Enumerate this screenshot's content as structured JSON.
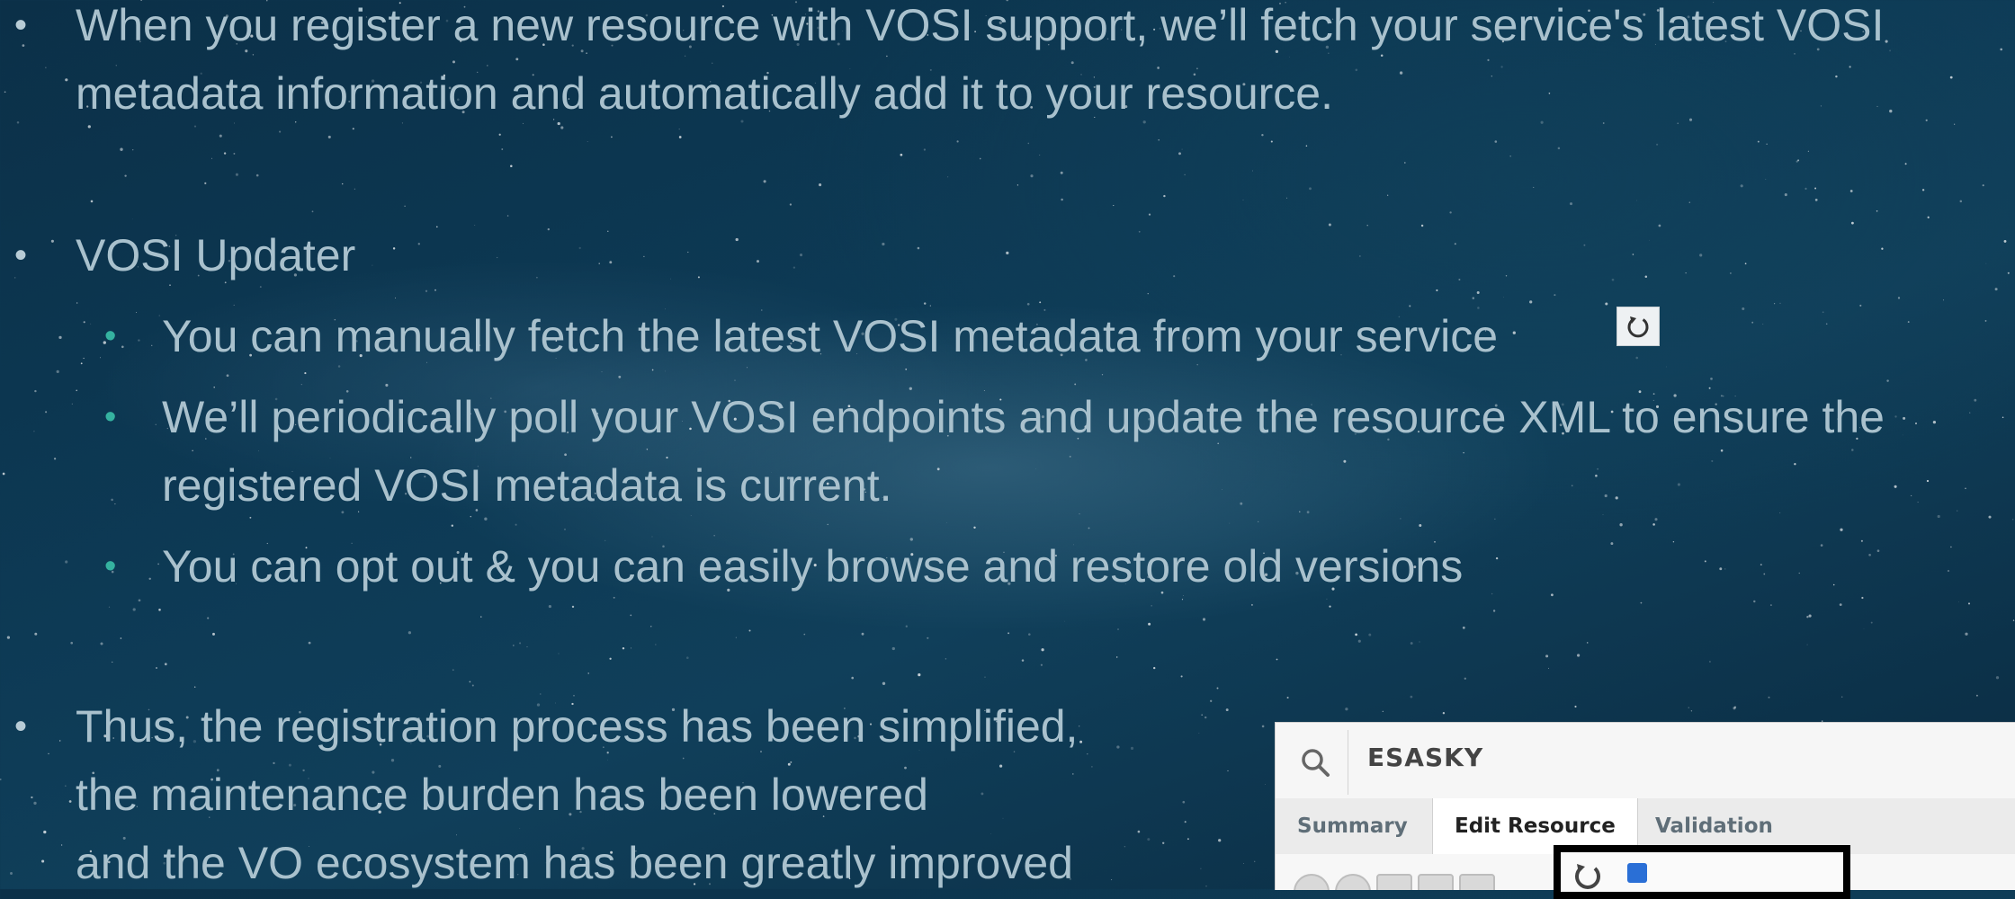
{
  "bullets": {
    "vosi_support": {
      "line1": "When you register a new resource with VOSI support, we’ll fetch your service's latest VOSI",
      "line2": "metadata information and automatically add it to your resource."
    },
    "vosi_updater": {
      "title": "VOSI Updater",
      "sub": [
        {
          "line1": "You can manually fetch the latest VOSI metadata from your service"
        },
        {
          "line1": "We’ll periodically poll your VOSI endpoints and update the resource XML to ensure the",
          "line2": "registered VOSI metadata is current."
        },
        {
          "line1": "You can opt out & you can easily browse and restore old versions"
        }
      ]
    },
    "thus": {
      "line1": "Thus, the registration process has been simplified,",
      "line2": "the maintenance burden has been lowered",
      "line3": "and the VO ecosystem has been greatly improved"
    }
  },
  "refresh_button_icon": "refresh-icon",
  "panel": {
    "search_icon": "search-icon",
    "resource_name": "ESASKY",
    "tabs": [
      "Summary",
      "Edit Resource",
      "Validation"
    ],
    "active_tab": "Edit Resource",
    "highlight_text": "",
    "after_text": ""
  }
}
